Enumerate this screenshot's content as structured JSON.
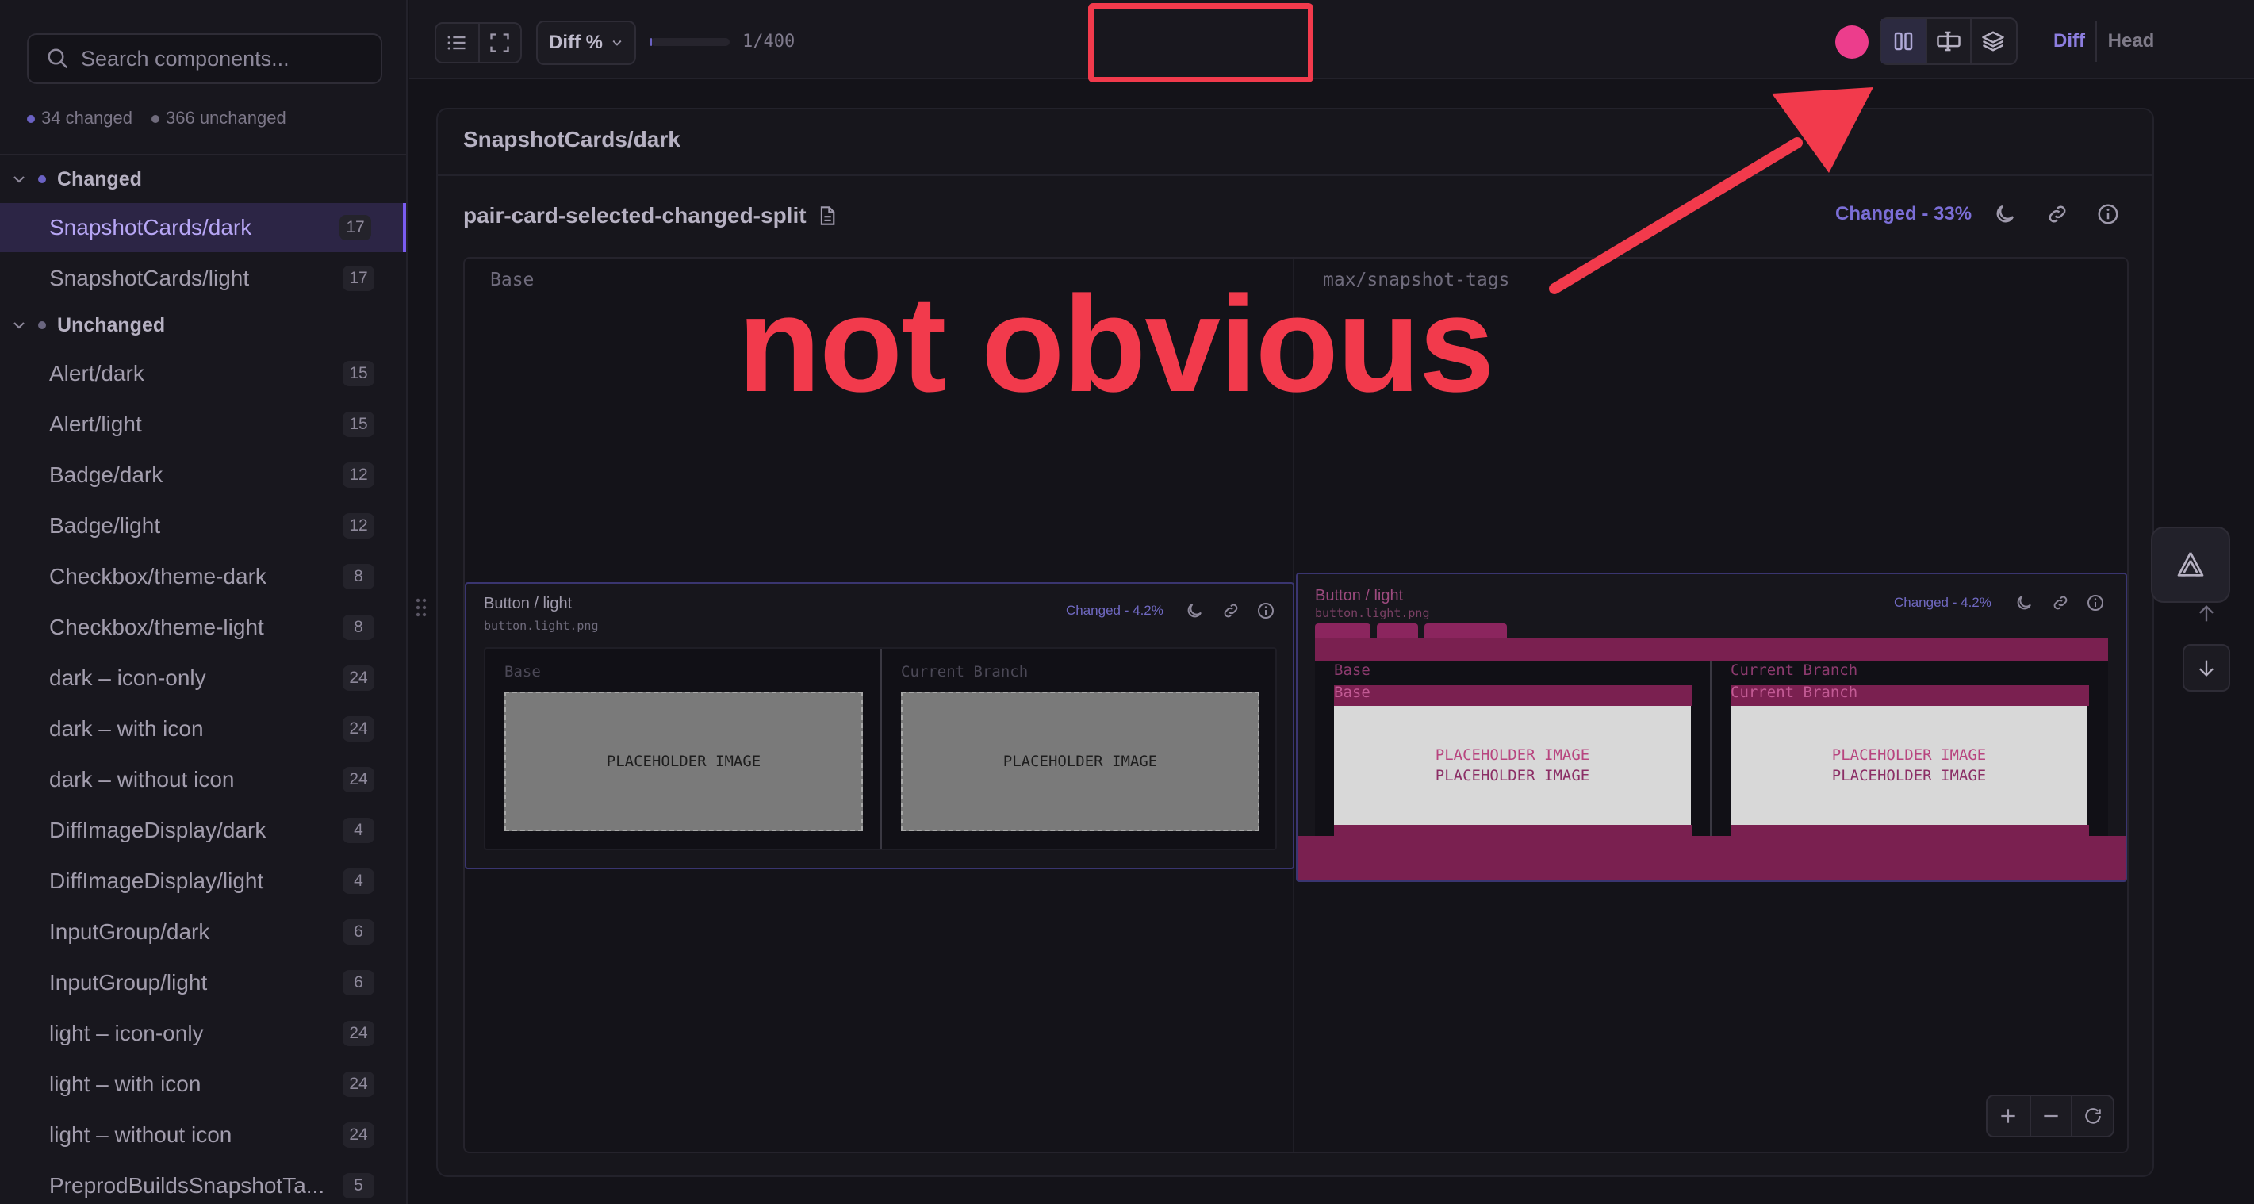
{
  "sidebar": {
    "search_placeholder": "Search components...",
    "changed_count": "34 changed",
    "unchanged_count": "366 unchanged",
    "groups": [
      {
        "label": "Changed"
      },
      {
        "label": "Unchanged"
      }
    ],
    "changed_items": [
      {
        "label": "SnapshotCards/dark",
        "count": "17"
      },
      {
        "label": "SnapshotCards/light",
        "count": "17"
      }
    ],
    "unchanged_items": [
      {
        "label": "Alert/dark",
        "count": "15"
      },
      {
        "label": "Alert/light",
        "count": "15"
      },
      {
        "label": "Badge/dark",
        "count": "12"
      },
      {
        "label": "Badge/light",
        "count": "12"
      },
      {
        "label": "Checkbox/theme-dark",
        "count": "8"
      },
      {
        "label": "Checkbox/theme-light",
        "count": "8"
      },
      {
        "label": "dark – icon-only",
        "count": "24"
      },
      {
        "label": "dark – with icon",
        "count": "24"
      },
      {
        "label": "dark – without icon",
        "count": "24"
      },
      {
        "label": "DiffImageDisplay/dark",
        "count": "4"
      },
      {
        "label": "DiffImageDisplay/light",
        "count": "4"
      },
      {
        "label": "InputGroup/dark",
        "count": "6"
      },
      {
        "label": "InputGroup/light",
        "count": "6"
      },
      {
        "label": "light – icon-only",
        "count": "24"
      },
      {
        "label": "light – with icon",
        "count": "24"
      },
      {
        "label": "light – without icon",
        "count": "24"
      },
      {
        "label": "PreprodBuildsSnapshotTa...",
        "count": "5"
      }
    ]
  },
  "toolbar": {
    "diff_dropdown": "Diff %",
    "progress_text": "1/400",
    "progress_fraction": 0.0025,
    "diff_tab": "Diff",
    "head_tab": "Head",
    "accent_color": "#ec3d8c"
  },
  "main": {
    "title": "SnapshotCards/dark",
    "story_name": "pair-card-selected-changed-split",
    "story_status": "Changed - 33%",
    "base_label": "Base",
    "branch_label": "max/snapshot-tags"
  },
  "card": {
    "title": "Button / light",
    "file": "button.light.png",
    "status": "Changed - 4.2%",
    "base_pane": "Base",
    "branch_pane": "Current Branch",
    "placeholder": "PLACEHOLDER IMAGE"
  },
  "annotation": {
    "text": "not obvious",
    "color": "#f23a4c"
  }
}
